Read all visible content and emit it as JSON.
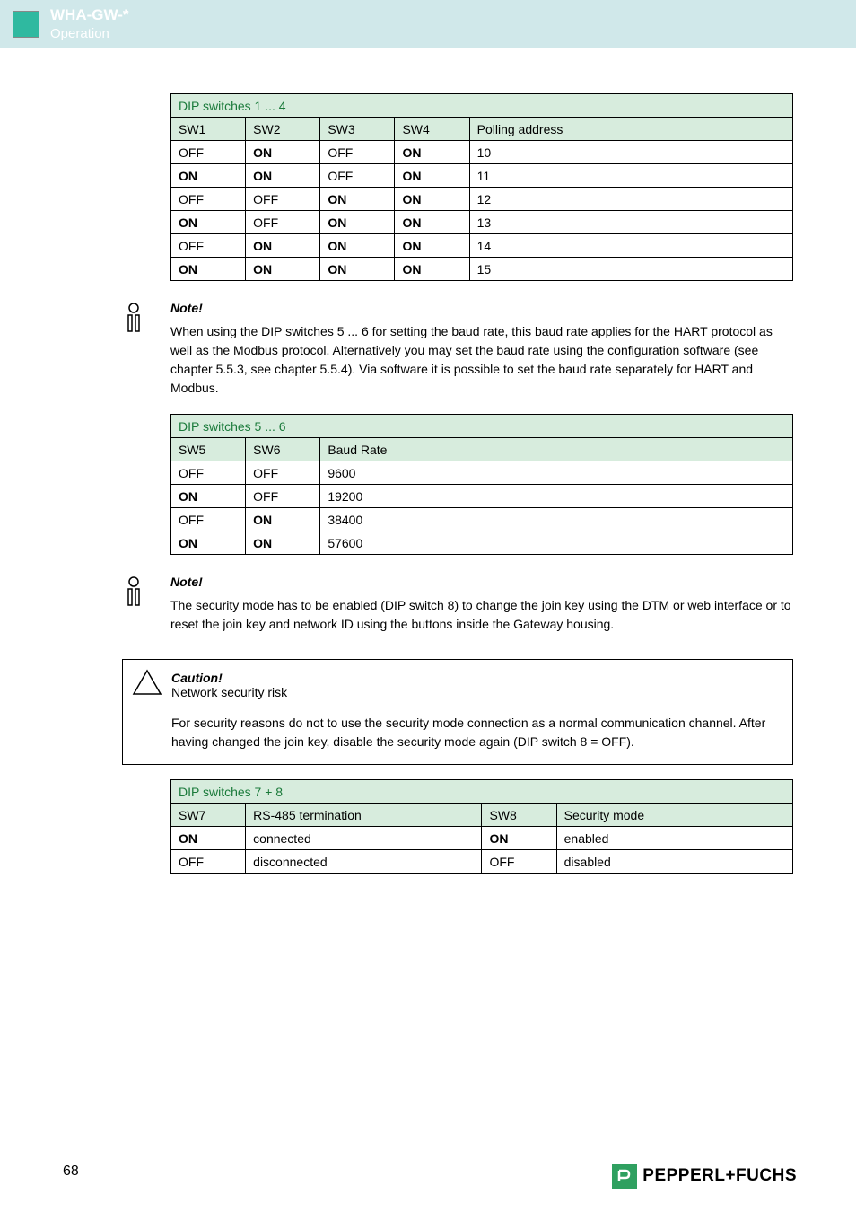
{
  "header": {
    "title": "WHA-GW-*",
    "subtitle": "Operation"
  },
  "table1": {
    "caption": "DIP switches 1 ... 4",
    "headers": [
      "SW1",
      "SW2",
      "SW3",
      "SW4",
      "Polling address"
    ],
    "rows": [
      [
        "OFF",
        "ON",
        "OFF",
        "ON",
        "10"
      ],
      [
        "ON",
        "ON",
        "OFF",
        "ON",
        "11"
      ],
      [
        "OFF",
        "OFF",
        "ON",
        "ON",
        "12"
      ],
      [
        "ON",
        "OFF",
        "ON",
        "ON",
        "13"
      ],
      [
        "OFF",
        "ON",
        "ON",
        "ON",
        "14"
      ],
      [
        "ON",
        "ON",
        "ON",
        "ON",
        "15"
      ]
    ]
  },
  "note1": {
    "title": "Note!",
    "body": "When using the DIP switches 5 ... 6 for setting the baud rate, this baud rate applies for the HART protocol as well as the Modbus protocol. Alternatively you may set the baud rate using the configuration software (see chapter 5.5.3, see chapter 5.5.4). Via software it is possible to set the baud rate separately for HART and Modbus."
  },
  "table2": {
    "caption": "DIP switches 5 ... 6",
    "headers": [
      "SW5",
      "SW6",
      "Baud Rate"
    ],
    "rows": [
      [
        "OFF",
        "OFF",
        "9600"
      ],
      [
        "ON",
        "OFF",
        "19200"
      ],
      [
        "OFF",
        "ON",
        "38400"
      ],
      [
        "ON",
        "ON",
        "57600"
      ]
    ]
  },
  "note2": {
    "title": "Note!",
    "body": "The security mode has to be enabled (DIP switch 8) to change the join key using the DTM or web interface or to reset the join key and network ID using the buttons inside the Gateway housing."
  },
  "caution": {
    "title": "Caution!",
    "subtitle": "Network security risk",
    "body": "For security reasons do not to use the security mode connection as a normal communication channel. After having changed the join key, disable the security mode again (DIP switch 8 = OFF)."
  },
  "table3": {
    "caption": "DIP switches 7 + 8",
    "headers": [
      "SW7",
      "RS-485 termination",
      "SW8",
      "Security mode"
    ],
    "rows": [
      [
        "ON",
        "connected",
        "ON",
        "enabled"
      ],
      [
        "OFF",
        "disconnected",
        "OFF",
        "disabled"
      ]
    ]
  },
  "page": "68",
  "brand": "PEPPERL+FUCHS",
  "chart_data": [
    {
      "type": "table",
      "title": "DIP switches 1 ... 4",
      "columns": [
        "SW1",
        "SW2",
        "SW3",
        "SW4",
        "Polling address"
      ],
      "rows": [
        [
          "OFF",
          "ON",
          "OFF",
          "ON",
          10
        ],
        [
          "ON",
          "ON",
          "OFF",
          "ON",
          11
        ],
        [
          "OFF",
          "OFF",
          "ON",
          "ON",
          12
        ],
        [
          "ON",
          "OFF",
          "ON",
          "ON",
          13
        ],
        [
          "OFF",
          "ON",
          "ON",
          "ON",
          14
        ],
        [
          "ON",
          "ON",
          "ON",
          "ON",
          15
        ]
      ]
    },
    {
      "type": "table",
      "title": "DIP switches 5 ... 6",
      "columns": [
        "SW5",
        "SW6",
        "Baud Rate"
      ],
      "rows": [
        [
          "OFF",
          "OFF",
          9600
        ],
        [
          "ON",
          "OFF",
          19200
        ],
        [
          "OFF",
          "ON",
          38400
        ],
        [
          "ON",
          "ON",
          57600
        ]
      ]
    },
    {
      "type": "table",
      "title": "DIP switches 7 + 8",
      "columns": [
        "SW7",
        "RS-485 termination",
        "SW8",
        "Security mode"
      ],
      "rows": [
        [
          "ON",
          "connected",
          "ON",
          "enabled"
        ],
        [
          "OFF",
          "disconnected",
          "OFF",
          "disabled"
        ]
      ]
    }
  ]
}
